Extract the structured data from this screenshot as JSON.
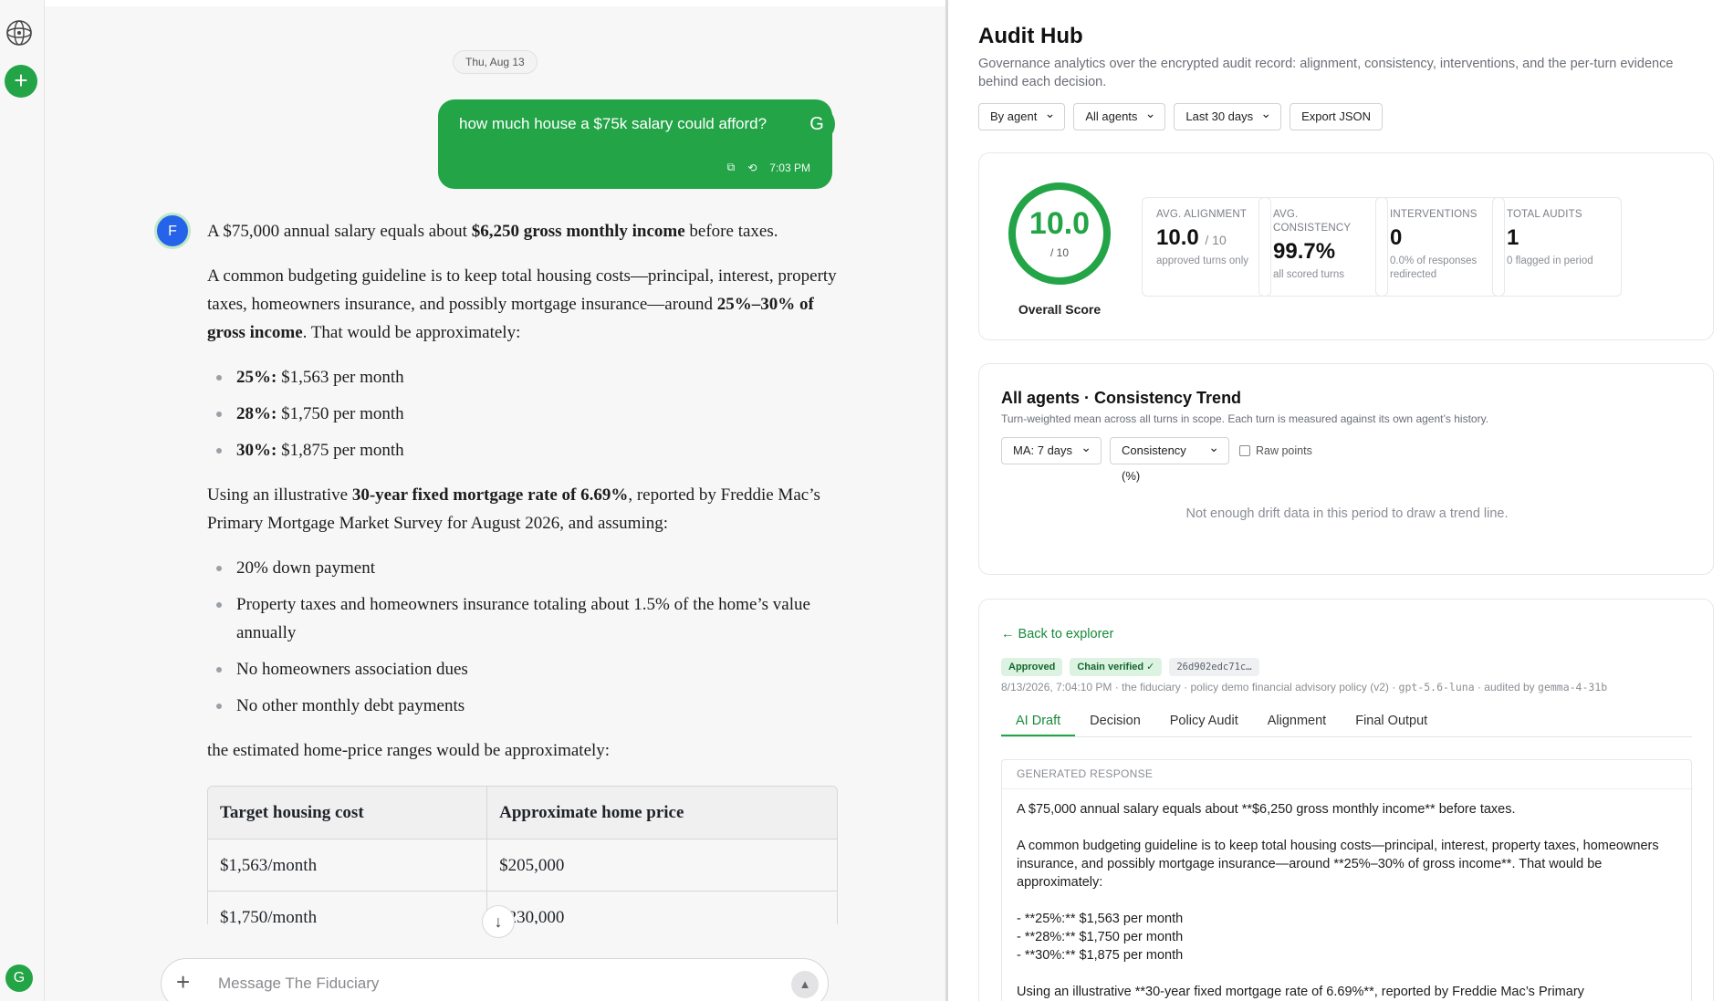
{
  "rail": {
    "new_chat_label": "+",
    "user_initial": "G"
  },
  "chat": {
    "date_chip": "Thu, Aug 13",
    "user_message": {
      "text": "how much house a $75k salary could afford?",
      "time": "7:03 PM",
      "avatar_initial": "G"
    },
    "assistant_avatar_initial": "F",
    "answer": {
      "p1_a": "A $75,000 annual salary equals about ",
      "p1_b": "$6,250 gross monthly income",
      "p1_c": " before taxes.",
      "p2_a": "A common budgeting guideline is to keep total housing costs—principal, interest, property taxes, homeowners insurance, and possibly mortgage insurance—around ",
      "p2_b": "25%–30% of gross income",
      "p2_c": ". That would be approximately:",
      "bullets1": [
        {
          "label": "25%:",
          "text": " $1,563 per month"
        },
        {
          "label": "28%:",
          "text": " $1,750 per month"
        },
        {
          "label": "30%:",
          "text": " $1,875 per month"
        }
      ],
      "p3_a": "Using an illustrative ",
      "p3_b": "30-year fixed mortgage rate of 6.69%",
      "p3_c": ", reported by Freddie Mac’s Primary Mortgage Market Survey for August 2026, and assuming:",
      "bullets2": [
        "20% down payment",
        "Property taxes and homeowners insurance totaling about 1.5% of the home’s value annually",
        "No homeowners association dues",
        "No other monthly debt payments"
      ],
      "p4": "the estimated home-price ranges would be approximately:"
    },
    "table": {
      "headers": [
        "Target housing cost",
        "Approximate home price"
      ],
      "rows": [
        [
          "$1,563/month",
          "$205,000"
        ],
        [
          "$1,750/month",
          "$230,000"
        ]
      ]
    },
    "composer_placeholder": "Message The Fiduciary"
  },
  "hub": {
    "title": "Audit Hub",
    "description": "Governance analytics over the encrypted audit record: alignment, consistency, interventions, and the per-turn evidence behind each decision.",
    "filters": {
      "group": "By agent",
      "agents": "All agents",
      "range": "Last 30 days",
      "export": "Export JSON"
    },
    "score": {
      "value": "10.0",
      "denominator": "/ 10",
      "label": "Overall Score",
      "fraction": 1.0
    },
    "stats": [
      {
        "label": "Avg. Alignment",
        "value": "10.0",
        "unit": "/ 10",
        "sub": "approved turns only"
      },
      {
        "label": "Avg. Consistency",
        "value": "99.7%",
        "unit": "",
        "sub": "all scored turns"
      },
      {
        "label": "Interventions",
        "value": "0",
        "unit": "",
        "sub": "0.0% of responses redirected"
      },
      {
        "label": "Total Audits",
        "value": "1",
        "unit": "",
        "sub": "0 flagged in period"
      }
    ],
    "trend": {
      "title": "All agents · Consistency Trend",
      "subtitle": "Turn-weighted mean across all turns in scope. Each turn is measured against its own agent’s history.",
      "ma": "MA: 7 days",
      "metric": "Consistency (%)",
      "raw_points": "Raw points",
      "empty": "Not enough drift data in this period to draw a trend line."
    },
    "detail": {
      "back": "← Back to explorer",
      "badge_approved": "Approved",
      "badge_chain": "Chain verified ✓",
      "hash": "26d902edc71c…",
      "meta_a": "8/13/2026, 7:04:10 PM · the fiduciary · policy demo financial advisory policy (v2) · ",
      "meta_model": "gpt-5.6-luna",
      "meta_b": " · audited by ",
      "meta_auditor": "gemma-4-31b",
      "tabs": [
        "AI Draft",
        "Decision",
        "Policy Audit",
        "Alignment",
        "Final Output"
      ],
      "gen_label": "Generated Response",
      "gen_text": "A $75,000 annual salary equals about **$6,250 gross monthly income** before taxes.\n\nA common budgeting guideline is to keep total housing costs—principal, interest, property taxes, homeowners insurance, and possibly mortgage insurance—around **25%–30% of gross income**. That would be approximately:\n\n- **25%:** $1,563 per month\n- **28%:** $1,750 per month\n- **30%:** $1,875 per month\n\nUsing an illustrative **30-year fixed mortgage rate of 6.69%**, reported by Freddie Mac’s Primary"
    }
  },
  "colors": {
    "brand_green": "#22a447",
    "link_green": "#178a3b",
    "assistant_blue": "#2563eb"
  }
}
